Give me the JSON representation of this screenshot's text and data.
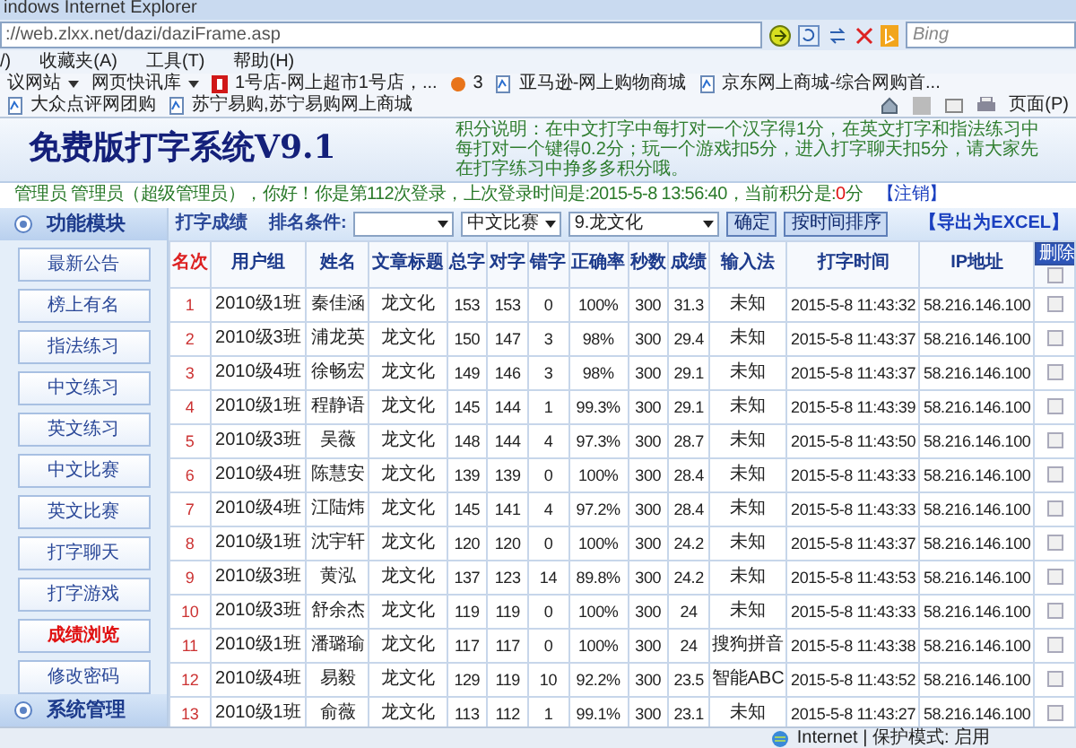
{
  "browser": {
    "title": "indows Internet Explorer",
    "address": "://web.zlxx.net/dazi/daziFrame.asp",
    "search_placeholder": "Bing",
    "menu": [
      "/)",
      "收藏夹(A)",
      "工具(T)",
      "帮助(H)"
    ],
    "favorites": [
      {
        "label": "议网站",
        "kind": "dropdown"
      },
      {
        "label": "网页快讯库",
        "kind": "dropdown"
      },
      {
        "label": "1号店-网上超市1号店，...",
        "kind": "red"
      },
      {
        "label": "3",
        "kind": "fire"
      },
      {
        "label": "亚马逊-网上购物商城",
        "kind": "page"
      },
      {
        "label": "京东网上商城-综合网购首...",
        "kind": "page"
      },
      {
        "label": "大众点评网团购",
        "kind": "page"
      },
      {
        "label": "苏宁易购,苏宁易购网上商城",
        "kind": "page"
      }
    ],
    "page_menu": "页面(P)"
  },
  "page": {
    "title": "免费版打字系统V9.1",
    "score_note": "积分说明：在中文打字中每打对一个汉字得1分，在英文打字和指法练习中每打对一个键得0.2分；玩一个游戏扣5分，进入打字聊天扣5分，请大家先在打字练习中挣多多积分哦。",
    "login": {
      "text": "管理员 管理员（超级管理员），你好！你是第112次登录，上次登录时间是:2015-5-8 13:56:40，当前积分是:",
      "points": "0",
      "unit": "分",
      "logout": "【注销】"
    }
  },
  "sidebar": {
    "header": "功能模块",
    "footer": "系统管理",
    "items": [
      {
        "label": "最新公告",
        "selected": false
      },
      {
        "label": "榜上有名",
        "selected": false
      },
      {
        "label": "指法练习",
        "selected": false
      },
      {
        "label": "中文练习",
        "selected": false
      },
      {
        "label": "英文练习",
        "selected": false
      },
      {
        "label": "中文比赛",
        "selected": false
      },
      {
        "label": "英文比赛",
        "selected": false
      },
      {
        "label": "打字聊天",
        "selected": false
      },
      {
        "label": "打字游戏",
        "selected": false
      },
      {
        "label": "成绩浏览",
        "selected": true
      },
      {
        "label": "修改密码",
        "selected": false
      }
    ]
  },
  "toolbar": {
    "title": "打字成绩",
    "rank_label": "排名条件:",
    "selects": [
      {
        "kind": "empty"
      },
      {
        "kind": "filled",
        "value": "中文比赛"
      },
      {
        "kind": "filled",
        "value": "9.龙文化"
      }
    ],
    "buttons": [
      "确定",
      "按时间排序"
    ],
    "export": "【导出为EXCEL】"
  },
  "table": {
    "columns": [
      "名次",
      "用户组",
      "姓名",
      "文章标题",
      "总字",
      "对字",
      "错字",
      "正确率",
      "秒数",
      "成绩",
      "输入法",
      "打字时间",
      "IP地址"
    ],
    "delete_button": "删除",
    "select_all_checked": false,
    "rows": [
      {
        "cells": [
          "1",
          "2010级1班",
          "秦佳涵",
          "龙文化",
          "153",
          "153",
          "0",
          "100%",
          "300",
          "31.3",
          "未知",
          "2015-5-8 11:43:32",
          "58.216.146.100"
        ],
        "checked": false
      },
      {
        "cells": [
          "2",
          "2010级3班",
          "浦龙英",
          "龙文化",
          "150",
          "147",
          "3",
          "98%",
          "300",
          "29.4",
          "未知",
          "2015-5-8 11:43:37",
          "58.216.146.100"
        ],
        "checked": false
      },
      {
        "cells": [
          "3",
          "2010级4班",
          "徐畅宏",
          "龙文化",
          "149",
          "146",
          "3",
          "98%",
          "300",
          "29.1",
          "未知",
          "2015-5-8 11:43:37",
          "58.216.146.100"
        ],
        "checked": false
      },
      {
        "cells": [
          "4",
          "2010级1班",
          "程静语",
          "龙文化",
          "145",
          "144",
          "1",
          "99.3%",
          "300",
          "29.1",
          "未知",
          "2015-5-8 11:43:39",
          "58.216.146.100"
        ],
        "checked": false
      },
      {
        "cells": [
          "5",
          "2010级3班",
          "吴薇",
          "龙文化",
          "148",
          "144",
          "4",
          "97.3%",
          "300",
          "28.7",
          "未知",
          "2015-5-8 11:43:50",
          "58.216.146.100"
        ],
        "checked": false
      },
      {
        "cells": [
          "6",
          "2010级4班",
          "陈慧安",
          "龙文化",
          "139",
          "139",
          "0",
          "100%",
          "300",
          "28.4",
          "未知",
          "2015-5-8 11:43:33",
          "58.216.146.100"
        ],
        "checked": false
      },
      {
        "cells": [
          "7",
          "2010级4班",
          "江陆炜",
          "龙文化",
          "145",
          "141",
          "4",
          "97.2%",
          "300",
          "28.4",
          "未知",
          "2015-5-8 11:43:33",
          "58.216.146.100"
        ],
        "checked": false
      },
      {
        "cells": [
          "8",
          "2010级1班",
          "沈宇轩",
          "龙文化",
          "120",
          "120",
          "0",
          "100%",
          "300",
          "24.2",
          "未知",
          "2015-5-8 11:43:37",
          "58.216.146.100"
        ],
        "checked": false
      },
      {
        "cells": [
          "9",
          "2010级3班",
          "黄泓",
          "龙文化",
          "137",
          "123",
          "14",
          "89.8%",
          "300",
          "24.2",
          "未知",
          "2015-5-8 11:43:53",
          "58.216.146.100"
        ],
        "checked": false
      },
      {
        "cells": [
          "10",
          "2010级3班",
          "舒余杰",
          "龙文化",
          "119",
          "119",
          "0",
          "100%",
          "300",
          "24",
          "未知",
          "2015-5-8 11:43:33",
          "58.216.146.100"
        ],
        "checked": false
      },
      {
        "cells": [
          "11",
          "2010级1班",
          "潘璐瑜",
          "龙文化",
          "117",
          "117",
          "0",
          "100%",
          "300",
          "24",
          "搜狗拼音",
          "2015-5-8 11:43:38",
          "58.216.146.100"
        ],
        "checked": false
      },
      {
        "cells": [
          "12",
          "2010级4班",
          "易毅",
          "龙文化",
          "129",
          "119",
          "10",
          "92.2%",
          "300",
          "23.5",
          "智能ABC",
          "2015-5-8 11:43:52",
          "58.216.146.100"
        ],
        "checked": false
      },
      {
        "cells": [
          "13",
          "2010级1班",
          "俞薇",
          "龙文化",
          "113",
          "112",
          "1",
          "99.1%",
          "300",
          "23.1",
          "未知",
          "2015-5-8 11:43:27",
          "58.216.146.100"
        ],
        "checked": false
      }
    ]
  },
  "status_bar": {
    "zone": "Internet | 保护模式: 启用"
  }
}
